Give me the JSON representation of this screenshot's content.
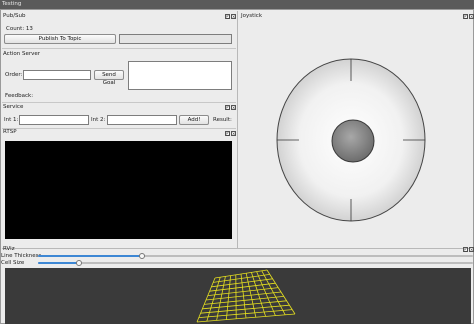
{
  "window": {
    "title": "Testing"
  },
  "pubsub": {
    "title": "Pub/Sub",
    "count_label": "Count: 13",
    "publish_button": "Publish To Topic",
    "topic_value": ""
  },
  "action_server": {
    "title": "Action Server",
    "order_label": "Order:",
    "order_value": "",
    "send_goal_button": "Send Goal",
    "feedback_label": "Feedback:"
  },
  "service": {
    "title": "Service",
    "int1_label": "Int 1:",
    "int1_value": "",
    "int2_label": "Int 2:",
    "int2_value": "",
    "add_button": "Add!",
    "result_label": "Result:"
  },
  "rtsp": {
    "title": "RTSP"
  },
  "joystick": {
    "title": "Joystick"
  },
  "rviz": {
    "title": "RViz",
    "line_thickness_label": "Line Thickness",
    "line_thickness_level": 0.24,
    "cell_size_label": "Cell Size",
    "cell_size_level": 0.095
  },
  "icons": {
    "float": "float-icon",
    "close": "close-icon"
  }
}
